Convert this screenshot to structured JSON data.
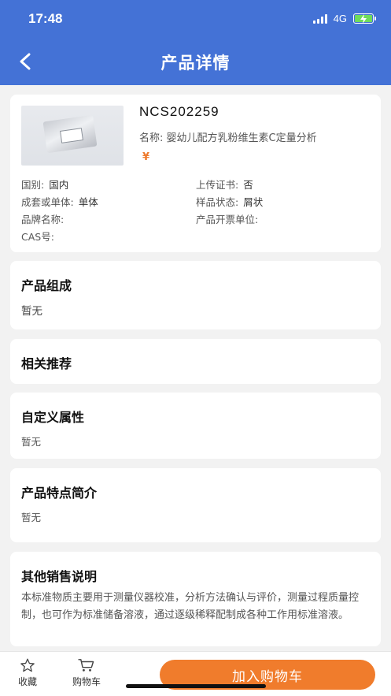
{
  "status_bar": {
    "time": "17:48",
    "network": "4G"
  },
  "header": {
    "title": "产品详情"
  },
  "product": {
    "code": "NCS202259",
    "name_label": "名称:",
    "name": "婴幼儿配方乳粉维生素C定量分析",
    "price_symbol": "¥",
    "attributes": {
      "country_label": "国别:",
      "country": "国内",
      "upload_cert_label": "上传证书:",
      "upload_cert": "否",
      "set_label": "成套或单体:",
      "set": "单体",
      "sample_state_label": "样品状态:",
      "sample_state": "屑状",
      "brand_label": "品牌名称:",
      "brand": "",
      "invoice_label": "产品开票单位:",
      "invoice": "",
      "cas_label": "CAS号:",
      "cas": ""
    }
  },
  "sections": {
    "composition": {
      "title": "产品组成",
      "body": "暂无"
    },
    "recommend": {
      "title": "相关推荐"
    },
    "custom_attrs": {
      "title": "自定义属性",
      "body": "暂无"
    },
    "features": {
      "title": "产品特点简介",
      "body": "暂无"
    },
    "other_sales": {
      "title": "其他销售说明",
      "body": "本标准物质主要用于测量仪器校准，分析方法确认与评价，测量过程质量控制，也可作为标准储备溶液，通过逐级稀释配制成各种工作用标准溶液。"
    }
  },
  "bottom_bar": {
    "favorite_label": "收藏",
    "cart_label": "购物车",
    "add_to_cart_label": "加入购物车"
  },
  "colors": {
    "header": "#4472d6",
    "accent": "#f07c2c",
    "price": "#ee7b2e"
  },
  "icons": [
    "back-icon",
    "signal-icon",
    "battery-icon",
    "star-icon",
    "cart-icon"
  ]
}
